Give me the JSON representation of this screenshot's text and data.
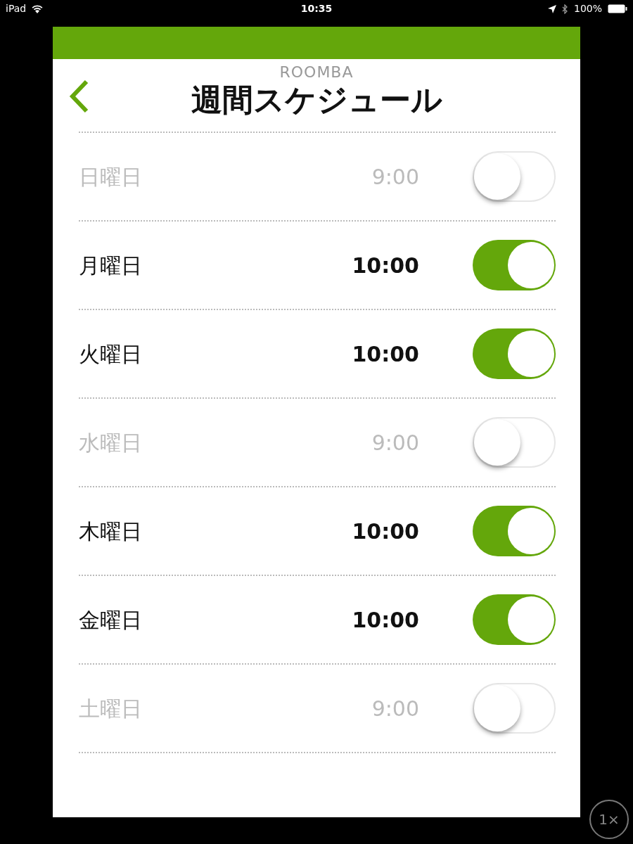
{
  "status_bar": {
    "device": "iPad",
    "time": "10:35",
    "battery": "100%"
  },
  "header": {
    "subtitle": "ROOMBA",
    "title": "週間スケジュール"
  },
  "days": [
    {
      "day": "日曜日",
      "time": "9:00",
      "on": false
    },
    {
      "day": "月曜日",
      "time": "10:00",
      "on": true
    },
    {
      "day": "火曜日",
      "time": "10:00",
      "on": true
    },
    {
      "day": "水曜日",
      "time": "9:00",
      "on": false
    },
    {
      "day": "木曜日",
      "time": "10:00",
      "on": true
    },
    {
      "day": "金曜日",
      "time": "10:00",
      "on": true
    },
    {
      "day": "土曜日",
      "time": "9:00",
      "on": false
    }
  ],
  "zoom_button": {
    "label": "1×"
  }
}
